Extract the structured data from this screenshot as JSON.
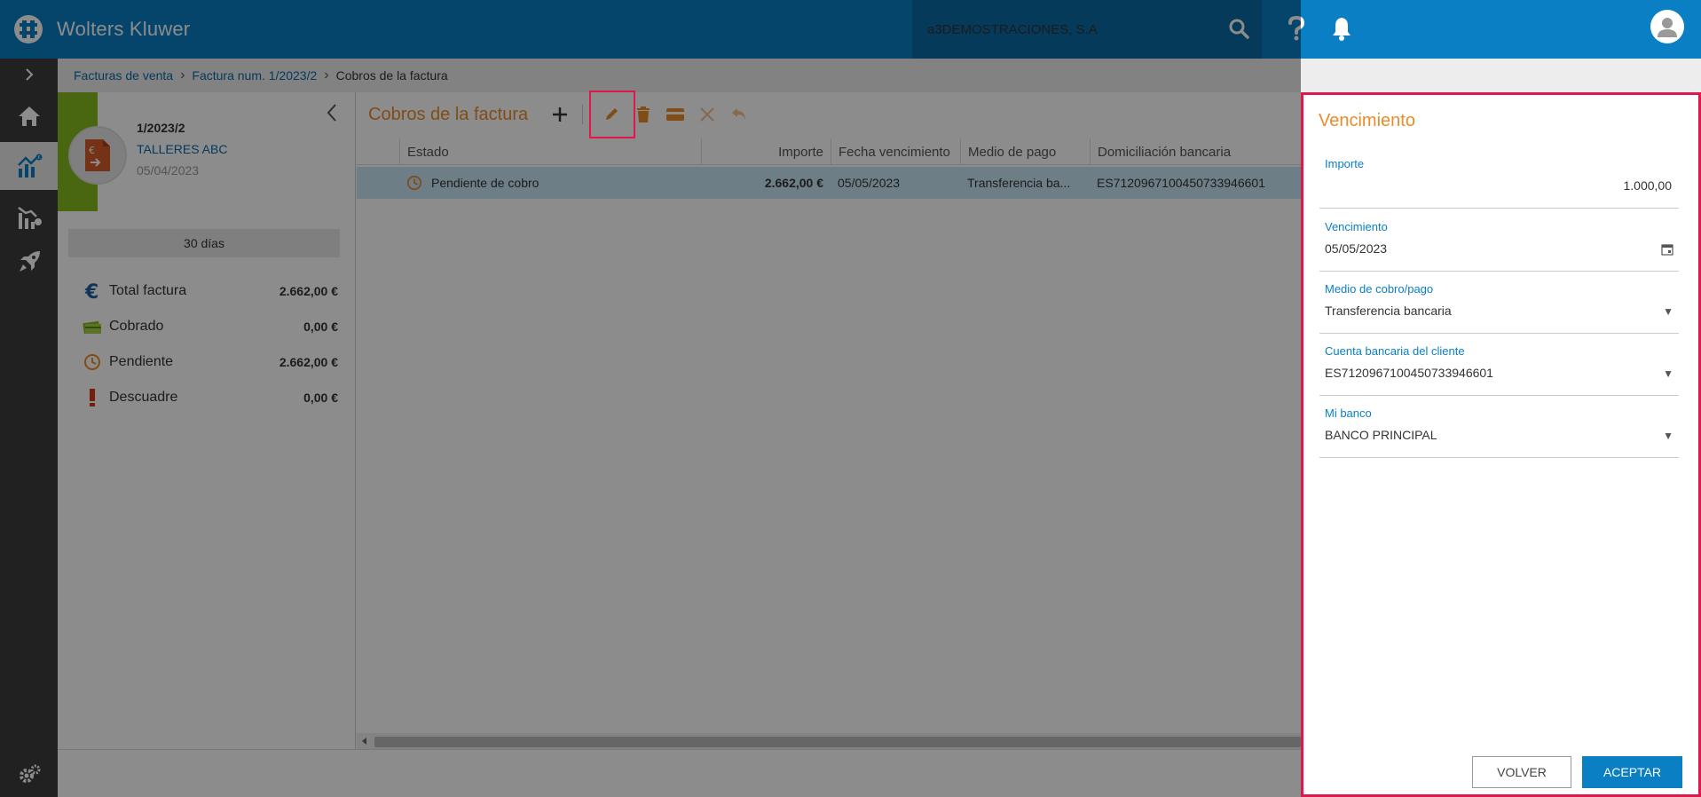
{
  "header": {
    "brand": "Wolters Kluwer",
    "company": "a3DEMOSTRACIONES, S.A"
  },
  "breadcrumb": {
    "item1": "Facturas de venta",
    "item2": "Factura num. 1/2023/2",
    "current": "Cobros de la factura"
  },
  "invoice": {
    "number": "1/2023/2",
    "client": "TALLERES ABC",
    "date": "05/04/2023",
    "days": "30 días"
  },
  "summary": [
    {
      "label": "Total factura",
      "value": "2.662,00 €"
    },
    {
      "label": "Cobrado",
      "value": "0,00 €"
    },
    {
      "label": "Pendiente",
      "value": "2.662,00 €"
    },
    {
      "label": "Descuadre",
      "value": "0,00 €"
    }
  ],
  "content": {
    "title": "Cobros de la factura",
    "columns": {
      "estado": "Estado",
      "importe": "Importe",
      "fecha": "Fecha vencimiento",
      "medio": "Medio de pago",
      "domiciliacion": "Domiciliación bancaria"
    },
    "row": {
      "estado": "Pendiente de cobro",
      "importe": "2.662,00 €",
      "fecha": "05/05/2023",
      "medio": "Transferencia ba...",
      "domiciliacion": "ES7120967100450733946601"
    }
  },
  "panel": {
    "title": "Vencimiento",
    "fields": {
      "importe_label": "Importe",
      "importe_value": "1.000,00",
      "vencimiento_label": "Vencimiento",
      "vencimiento_value": "05/05/2023",
      "medio_label": "Medio de cobro/pago",
      "medio_value": "Transferencia bancaria",
      "cuenta_label": "Cuenta bancaria del cliente",
      "cuenta_value": "ES7120967100450733946601",
      "banco_label": "Mi banco",
      "banco_value": "BANCO PRINCIPAL"
    },
    "volver": "VOLVER",
    "aceptar": "ACEPTAR"
  },
  "colors": {
    "topbar": "#0a7fc4",
    "accent_orange": "#ea8c2b",
    "highlight": "#e0174a",
    "green": "#85bc20"
  }
}
